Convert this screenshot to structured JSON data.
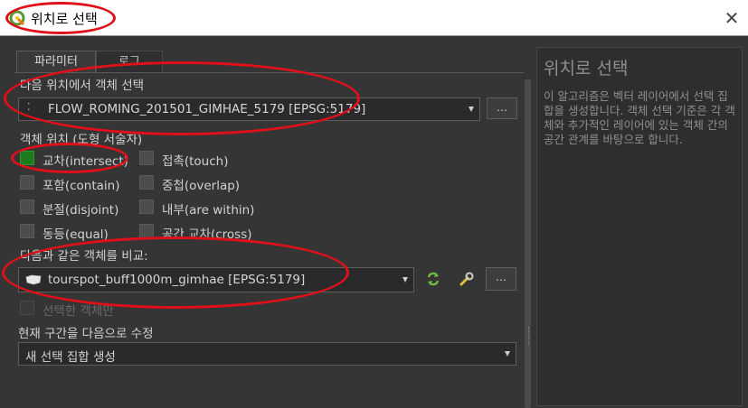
{
  "window": {
    "title": "위치로 선택",
    "close_label": "✕"
  },
  "tabs": [
    {
      "label": "파라미터",
      "active": true
    },
    {
      "label": "로그",
      "active": false
    }
  ],
  "params": {
    "select_from_label": "다음 위치에서 객체 선택",
    "select_from_layer": "FLOW_ROMING_201501_GIMHAE_5179 [EPSG:5179]",
    "select_from_button": "…",
    "predicate_label": "객체 위치 (도형 서술자)",
    "predicates": [
      {
        "label": "교차(intersect)",
        "checked": true
      },
      {
        "label": "접촉(touch)",
        "checked": false
      },
      {
        "label": "포함(contain)",
        "checked": false
      },
      {
        "label": "중첩(overlap)",
        "checked": false
      },
      {
        "label": "분절(disjoint)",
        "checked": false
      },
      {
        "label": "내부(are within)",
        "checked": false
      },
      {
        "label": "동등(equal)",
        "checked": false
      },
      {
        "label": "공간 교차(cross)",
        "checked": false
      }
    ],
    "compare_label": "다음과 같은 객체를 비교:",
    "compare_layer": "tourspot_buff1000m_gimhae [EPSG:5179]",
    "compare_button": "…",
    "selected_only_label": "선택한 객체만",
    "modify_label": "현재 구간을 다음으로 수정",
    "modify_value": "새 선택 집합 생성"
  },
  "help": {
    "title": "위치로 선택",
    "body": "이 알고리즘은 벡터 레이어에서 선택 집합을 생성합니다. 객체 선택 기준은 각 객체와 추가적인 레이어에 있는 객체 간의 공간 관계를 바탕으로 합니다."
  },
  "colors": {
    "accent_checked": "#1f7a1f",
    "annotation": "#e0101a",
    "titlebar": "#ffffff",
    "background": "#353535"
  }
}
